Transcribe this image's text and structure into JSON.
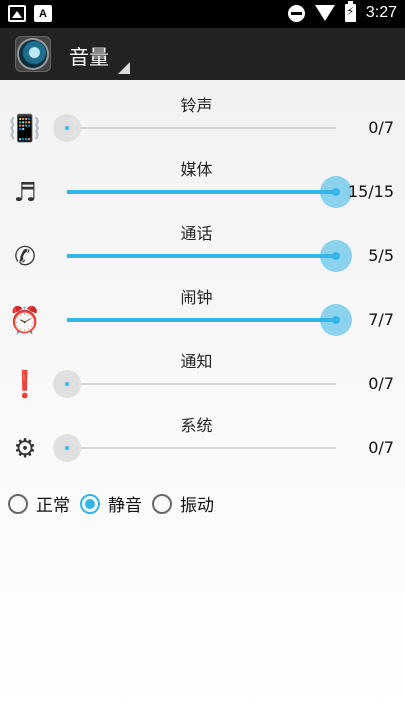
{
  "status_bar": {
    "time": "3:27",
    "left_icons": [
      "image-notification-icon",
      "font-notification-icon"
    ],
    "right_icons": [
      "do-not-disturb-icon",
      "wifi-icon",
      "battery-charging-icon"
    ],
    "font_icon_letter": "A"
  },
  "action_bar": {
    "title": "音量"
  },
  "accent_color": "#33b5e5",
  "volumes": [
    {
      "label": "铃声",
      "icon": "vibrate-phone-icon",
      "value_text": "0/7",
      "level": 0
    },
    {
      "label": "媒体",
      "icon": "music-note-icon",
      "value_text": "15/15",
      "level": 1
    },
    {
      "label": "通话",
      "icon": "phone-call-icon",
      "value_text": "5/5",
      "level": 1
    },
    {
      "label": "闹钟",
      "icon": "alarm-clock-icon",
      "value_text": "7/7",
      "level": 1
    },
    {
      "label": "通知",
      "icon": "notification-icon",
      "value_text": "0/7",
      "level": 0
    },
    {
      "label": "系统",
      "icon": "gear-icon",
      "value_text": "0/7",
      "level": 0
    }
  ],
  "modes": [
    {
      "label": "正常",
      "checked": false
    },
    {
      "label": "静音",
      "checked": true
    },
    {
      "label": "振动",
      "checked": false
    }
  ]
}
